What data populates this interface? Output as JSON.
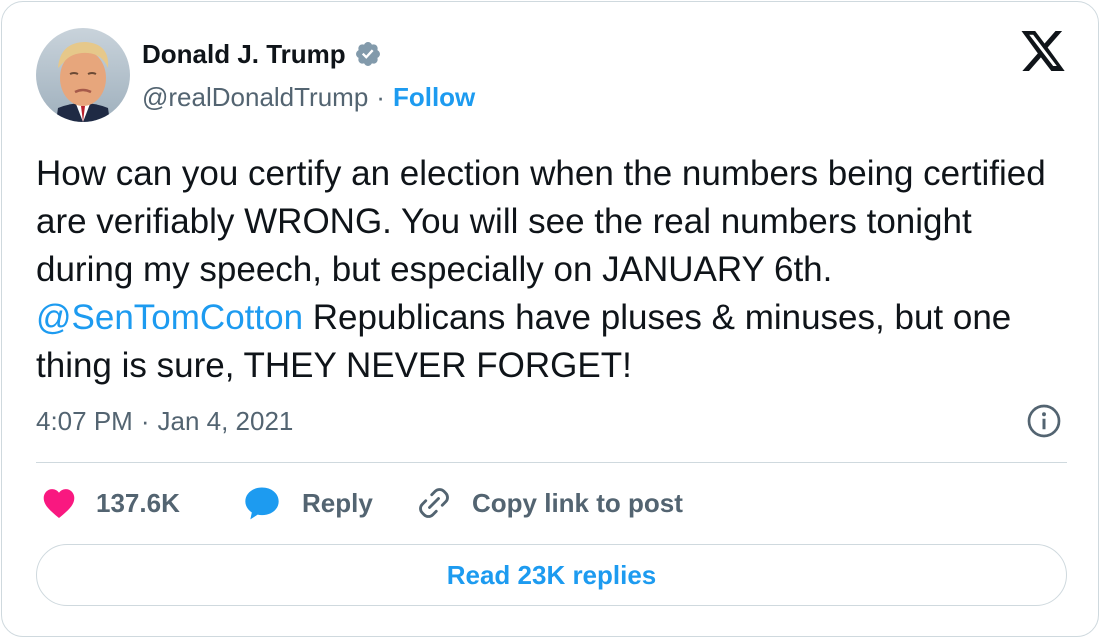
{
  "author": {
    "display_name": "Donald J. Trump",
    "handle": "@realDonaldTrump",
    "follow_label": "Follow",
    "separator": "·",
    "avatar_icon": "avatar-photo",
    "verified_icon": "verified-badge-icon"
  },
  "tweet": {
    "text_part1": "How can you certify an election when the numbers being certified are verifiably WRONG. You will see the real numbers tonight during my speech, but especially on JANUARY 6th. ",
    "mention": "@SenTomCotton",
    "text_part2": " Republicans have pluses & minuses, but one thing is sure, THEY NEVER FORGET!",
    "time": "4:07 PM",
    "separator": "·",
    "date": "Jan 4, 2021"
  },
  "actions": {
    "like_count": "137.6K",
    "reply_label": "Reply",
    "copy_link_label": "Copy link to post",
    "read_replies_label": "Read 23K replies"
  },
  "colors": {
    "accent": "#1d9bf0",
    "like": "#f91880",
    "text": "#0f1419",
    "muted": "#536471",
    "border": "#cfd9de",
    "verified": "#829aab"
  },
  "icons": {
    "brand": "x-logo-icon",
    "info": "info-icon",
    "like": "heart-icon",
    "reply": "speech-bubble-icon",
    "copy": "link-icon"
  }
}
